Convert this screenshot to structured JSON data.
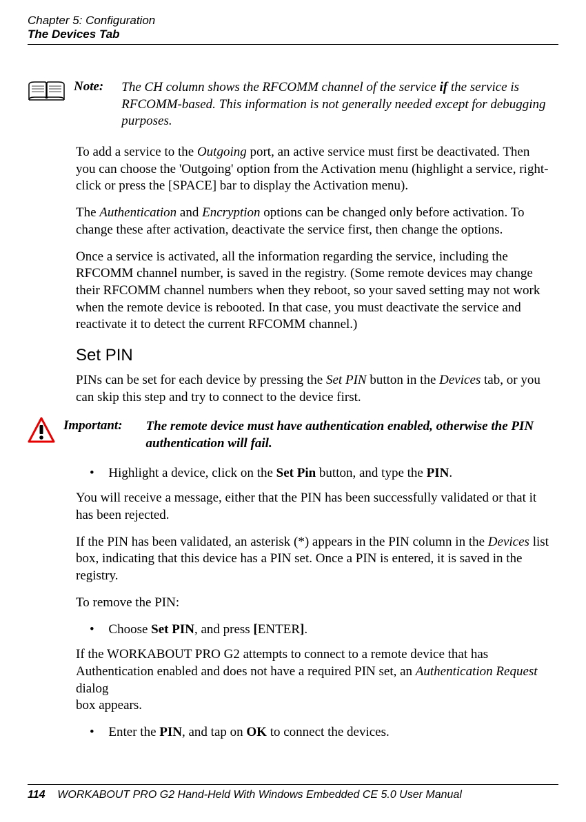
{
  "header": {
    "chapter": "Chapter 5: Configuration",
    "section": "The Devices Tab"
  },
  "note": {
    "label": "Note:",
    "text_before": "The CH column shows the RFCOMM channel of the service ",
    "text_bold": "if",
    "text_after": " the service is RFCOMM-based. This information is not generally needed except for debugging purposes."
  },
  "paras": {
    "p1a": "To add a service to the ",
    "p1_em": "Outgoing",
    "p1b": " port, an active service must first be deactivated. Then you can choose the 'Outgoing' option from the Activation menu (highlight a service, right-click or press the [SPACE] bar to display the Activation menu).",
    "p2a": "The ",
    "p2_em1": "Authentication",
    "p2b": " and ",
    "p2_em2": "Encryption",
    "p2c": " options can be changed only before activation. To change these after activation, deactivate the service first, then change the options.",
    "p3": "Once a service is activated, all the information regarding the service, including the RFCOMM channel number, is saved in the registry. (Some remote devices may change their RFCOMM channel numbers when they reboot, so your saved setting may not work when the remote device is rebooted. In that case, you must deactivate the service and reactivate it to detect the current RFCOMM channel.)"
  },
  "subheading": "Set PIN",
  "setpin": {
    "p1a": "PINs can be set for each device by pressing the ",
    "p1_em1": "Set PIN",
    "p1b": " button in the ",
    "p1_em2": "Devices",
    "p1c": " tab, or you can skip this step and try to connect to the device first."
  },
  "important": {
    "label": "Important:",
    "text": "The remote device must have authentication enabled, otherwise the PIN authentication will fail."
  },
  "bullet1": {
    "a": "Highlight a device, click on the ",
    "b1": "Set Pin",
    "c": " button, and type the ",
    "b2": "PIN",
    "d": "."
  },
  "post": {
    "p1": "You will receive a message, either that the PIN has been successfully validated or that it has been rejected.",
    "p2a": "If the PIN has been validated, an asterisk (*) appears in the PIN column in the ",
    "p2_em": "Devices",
    "p2b": " list box, indicating that this device has a PIN set. Once a PIN is entered, it is saved in the registry.",
    "p3": "To remove the PIN:"
  },
  "bullet2": {
    "a": "Choose ",
    "b1": "Set PIN",
    "c": ", and press ",
    "b2": "[",
    "d": "ENTER",
    "b3": "]",
    "e": "."
  },
  "post2": {
    "p1a": "If the WORKABOUT PRO G2 attempts to connect to a remote device that has Authentication enabled and does not have a required PIN set, an ",
    "p1_em": "Authentication Request",
    "p1b": " dialog",
    "p1c": "box appears."
  },
  "bullet3": {
    "a": "Enter the ",
    "b1": "PIN",
    "c": ", and tap on ",
    "b2": "OK",
    "d": " to connect the devices."
  },
  "footer": {
    "pagenum": "114",
    "text": "WORKABOUT PRO G2 Hand-Held With Windows Embedded CE 5.0 User Manual"
  }
}
